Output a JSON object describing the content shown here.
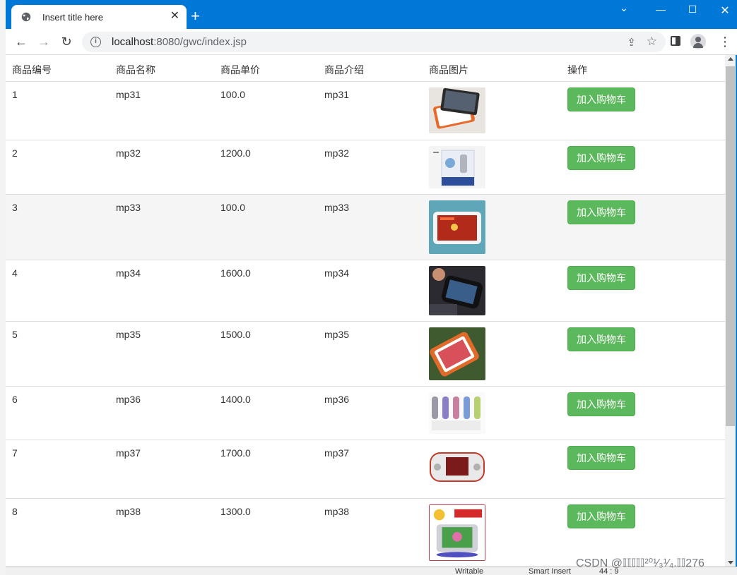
{
  "tab": {
    "title": "Insert title here"
  },
  "address_bar": {
    "host": "localhost",
    "path": ":8080/gwc/index.jsp"
  },
  "table": {
    "headers": [
      "商品编号",
      "商品名称",
      "商品单价",
      "商品介绍",
      "商品图片",
      "操作"
    ],
    "button_label": "加入购物车",
    "rows": [
      {
        "id": "1",
        "name": "mp31",
        "price": "100.0",
        "desc": "mp31"
      },
      {
        "id": "2",
        "name": "mp32",
        "price": "1200.0",
        "desc": "mp32"
      },
      {
        "id": "3",
        "name": "mp33",
        "price": "100.0",
        "desc": "mp33"
      },
      {
        "id": "4",
        "name": "mp34",
        "price": "1600.0",
        "desc": "mp34"
      },
      {
        "id": "5",
        "name": "mp35",
        "price": "1500.0",
        "desc": "mp35"
      },
      {
        "id": "6",
        "name": "mp36",
        "price": "1400.0",
        "desc": "mp36"
      },
      {
        "id": "7",
        "name": "mp37",
        "price": "1700.0",
        "desc": "mp37"
      },
      {
        "id": "8",
        "name": "mp38",
        "price": "1300.0",
        "desc": "mp38"
      }
    ]
  },
  "underlying_window": {
    "frag1": "Writable",
    "frag2": "Smart Insert",
    "frag3": "44 : 9"
  },
  "watermark": "CSDN @𝕀𝕀𝕀𝕀𝕀²⁰¹⁄₃¹⁄₄.𝕀𝕀276",
  "colors": {
    "chrome_blue": "#0078d7",
    "button_green": "#5cb85c",
    "row_stripe": "#f5f5f5"
  }
}
